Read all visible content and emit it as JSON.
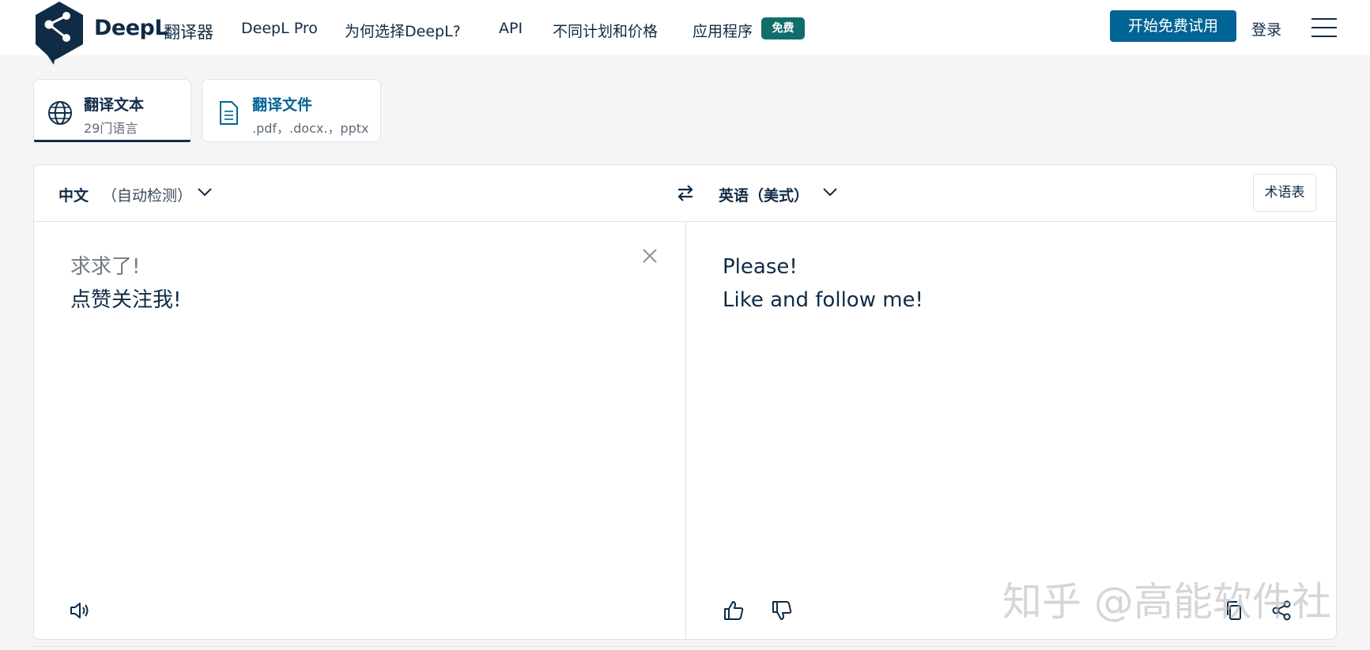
{
  "header": {
    "brand": "DeepL",
    "brand_sub": "翻译器",
    "nav": [
      "DeepL Pro",
      "为何选择DeepL?",
      "API",
      "不同计划和价格",
      "应用程序"
    ],
    "badge": "免费",
    "cta": "开始免费试用",
    "login": "登录"
  },
  "tabs": [
    {
      "title": "翻译文本",
      "subtitle": "29门语言",
      "active": true,
      "icon": "globe-icon"
    },
    {
      "title": "翻译文件",
      "subtitle": ".pdf，.docx.，pptx",
      "active": false,
      "icon": "document-icon"
    }
  ],
  "translator": {
    "source_lang": "中文",
    "source_detect": "（自动检测）",
    "target_lang": "英语（美式）",
    "glossary": "术语表",
    "source_lines": [
      "求求了!",
      "点赞关注我!"
    ],
    "target_lines": [
      "Please!",
      "Like and follow me!"
    ]
  },
  "watermark": "知乎 @高能软件社",
  "colors": {
    "brand_navy": "#0f2b46",
    "cta_blue": "#006494",
    "badge_teal": "#0f6e6b",
    "file_tab_blue": "#006494"
  }
}
